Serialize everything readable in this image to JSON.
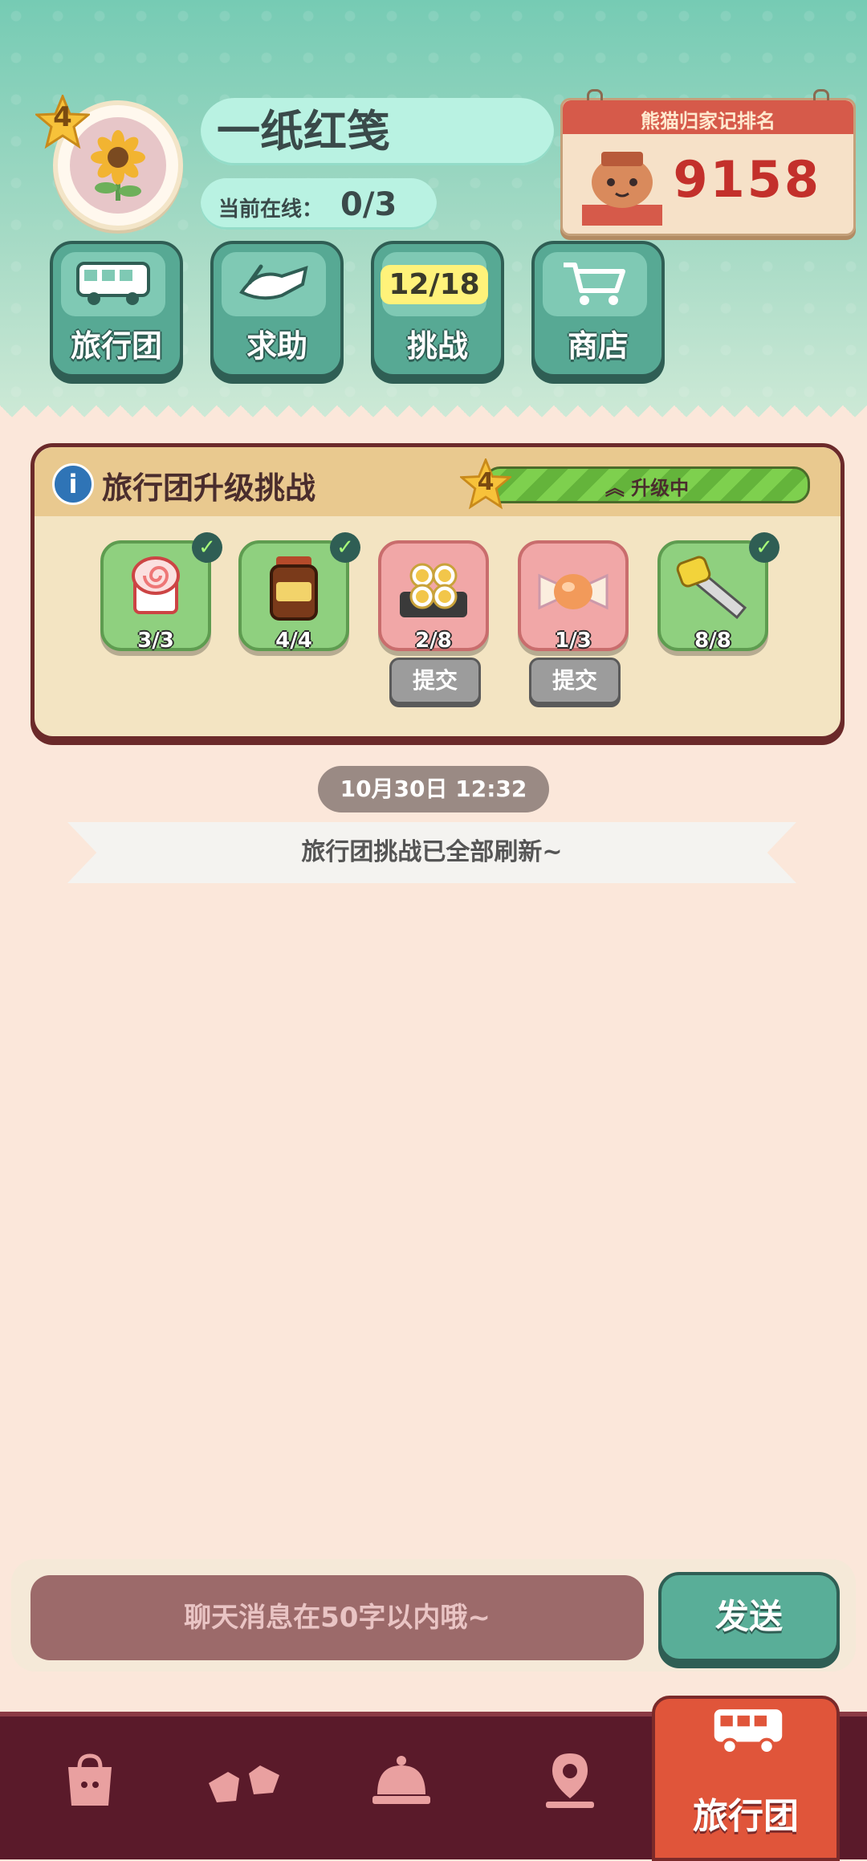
{
  "profile": {
    "level": "4",
    "name": "一纸红笺",
    "online_label": "当前在线：",
    "online_value": "0/3"
  },
  "rank": {
    "title": "熊猫归家记排名",
    "value": "9158"
  },
  "nav": [
    {
      "label": "旅行团",
      "icon": "bus-icon"
    },
    {
      "label": "求助",
      "icon": "helping-hand-icon"
    },
    {
      "label": "挑战",
      "badge": "12/18"
    },
    {
      "label": "商店",
      "icon": "shopping-cart-icon"
    }
  ],
  "challenge": {
    "title": "旅行团升级挑战",
    "level": "4",
    "status": "升级中",
    "items": [
      {
        "icon": "cake-roll-icon",
        "progress": "3/3",
        "done": true
      },
      {
        "icon": "jam-jar-icon",
        "progress": "4/4",
        "done": true
      },
      {
        "icon": "egg-tarts-icon",
        "progress": "2/8",
        "done": false,
        "action": "提交"
      },
      {
        "icon": "candy-icon",
        "progress": "1/3",
        "done": false,
        "action": "提交"
      },
      {
        "icon": "saw-icon",
        "progress": "8/8",
        "done": true
      }
    ]
  },
  "chat": {
    "timestamp": "10月30日 12:32",
    "system_message": "旅行团挑战已全部刷新~",
    "input_placeholder": "聊天消息在50字以内哦~",
    "send_label": "发送"
  },
  "tabs": [
    {
      "icon": "shopping-bag-icon"
    },
    {
      "icon": "hand-gesture-icon"
    },
    {
      "icon": "service-bell-icon"
    },
    {
      "icon": "map-pin-icon"
    },
    {
      "icon": "bus-icon",
      "label": "旅行团",
      "active": true
    }
  ],
  "colors": {
    "header_teal": "#76cbb4",
    "panel_cream": "#fbe7da",
    "tab_bar": "#5a1a2a",
    "active_tab": "#e0553a",
    "rank_red": "#c3302b"
  }
}
